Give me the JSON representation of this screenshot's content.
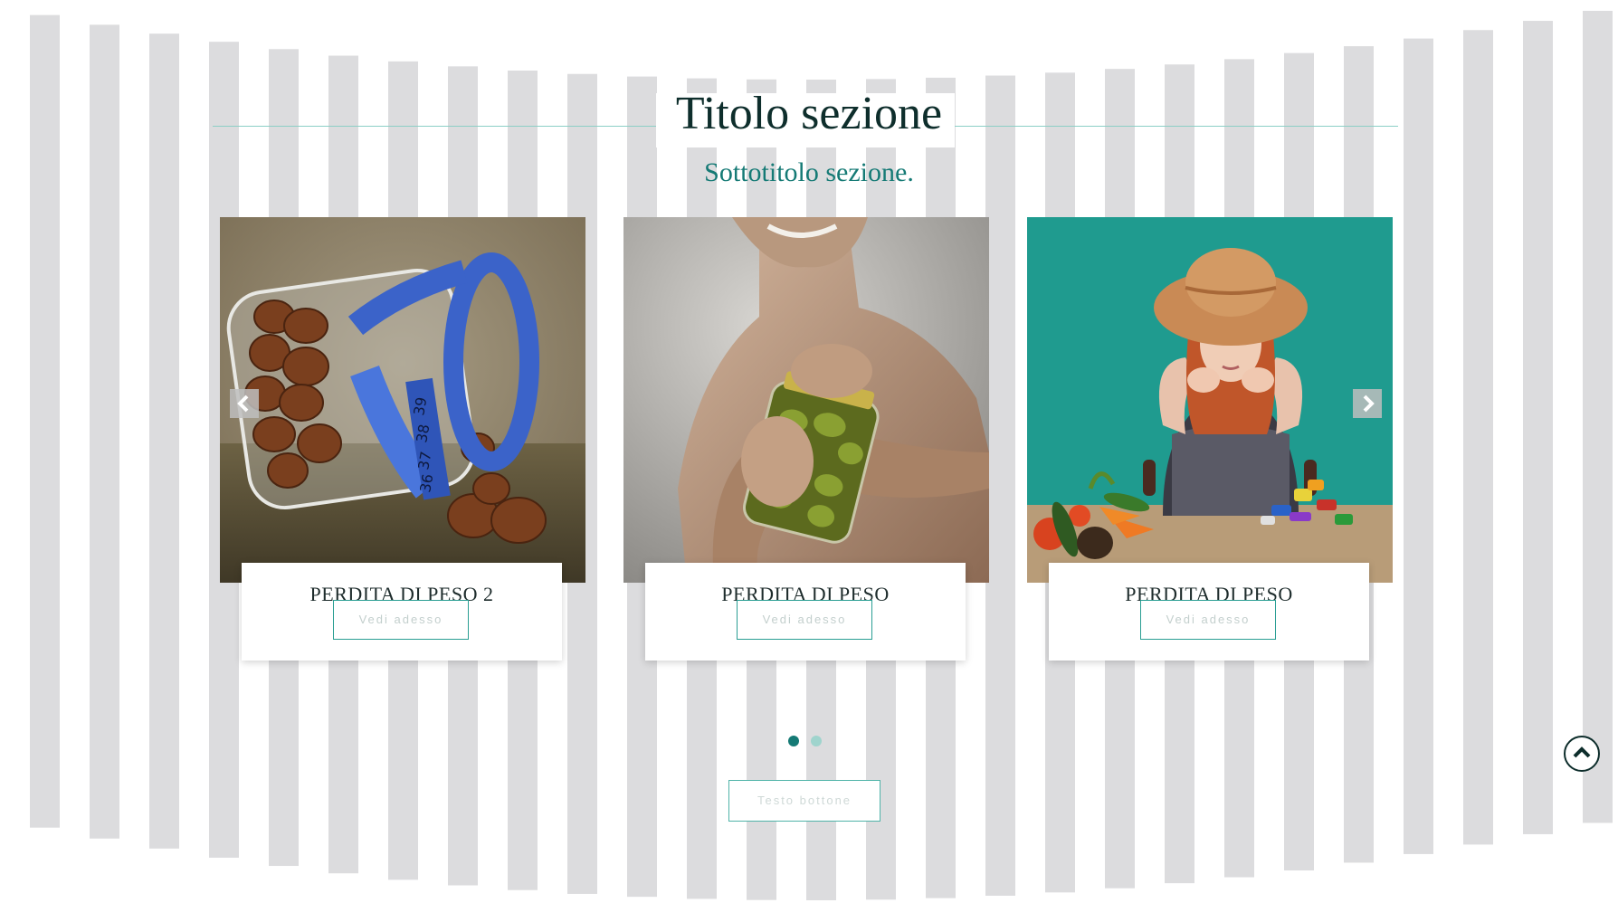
{
  "section": {
    "title": "Titolo sezione",
    "subtitle": "Sottotitolo sezione."
  },
  "carousel": {
    "cards": [
      {
        "title": "PERDITA DI PESO 2",
        "button_label": "Vedi adesso",
        "image": "hazelnuts-jar-measuring-tape"
      },
      {
        "title": "PERDITA DI PESO",
        "button_label": "Vedi adesso",
        "image": "man-opening-pickle-jar"
      },
      {
        "title": "PERDITA DI PESO",
        "button_label": "Vedi adesso",
        "image": "woman-with-hat-vegetables-sweets"
      }
    ],
    "prev_icon": "chevron-left-icon",
    "next_icon": "chevron-right-icon",
    "pagination": {
      "pages": 2,
      "active": 1
    }
  },
  "main_button": {
    "label": "Testo bottone"
  },
  "scroll_top": {
    "icon": "chevron-up-icon"
  },
  "colors": {
    "accent": "#157a75",
    "accent_light": "#9fd4cd",
    "title": "#0e2e2c",
    "stripe": "#dcdcde",
    "teal_background": "#1f9b8f"
  }
}
